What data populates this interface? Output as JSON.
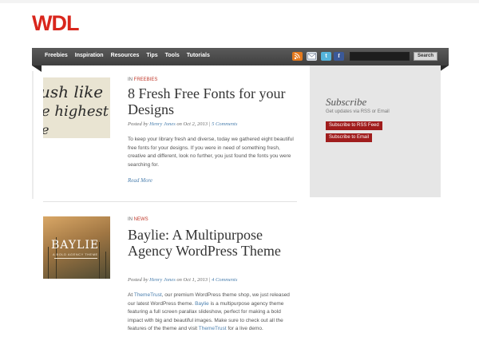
{
  "site": {
    "logo": "WDL"
  },
  "nav": {
    "items": [
      "Freebies",
      "Inspiration",
      "Resources",
      "Tips",
      "Tools",
      "Tutorials"
    ]
  },
  "social": {
    "icons": [
      "rss-icon",
      "mail-icon",
      "twitter-icon",
      "facebook-icon"
    ],
    "twitter_glyph": "t",
    "facebook_glyph": "f"
  },
  "search": {
    "button_label": "Search",
    "placeholder": "",
    "value": ""
  },
  "sidebar": {
    "title": "Subscribe",
    "subtitle": "Get updates via RSS or Email",
    "rss_button": "Subscribe to RSS Feed",
    "email_button": "Subscribe to Email"
  },
  "posts": [
    {
      "category_prefix": "IN",
      "category": "FREEBIES",
      "title": "8 Fresh Free Fonts for your Designs",
      "meta": {
        "posted_by": "Posted by",
        "author": "Henry Jones",
        "on": "on Oct 2, 2013",
        "sep": "|",
        "comments": "5 Comments"
      },
      "excerpt": "To keep your library fresh and diverse, today we gathered eight beautiful free fonts for your designs. If you were in need of something fresh, creative and different, look no further, you just found the fonts you were searching for.",
      "read_more": "Read More",
      "thumb_text": [
        "ush like",
        "e highest",
        "e"
      ]
    },
    {
      "category_prefix": "IN",
      "category": "NEWS",
      "title": "Baylie: A Multipurpose Agency WordPress Theme",
      "meta": {
        "posted_by": "Posted by",
        "author": "Henry Jones",
        "on": "on Oct 1, 2013",
        "sep": "|",
        "comments": "4 Comments"
      },
      "excerpt_parts": {
        "p1": "At ",
        "l1": "ThemeTrust",
        "p2": ", our premium WordPress theme shop, we just released our latest WordPress theme. ",
        "l2": "Baylie",
        "p3": " is a multipurpose agency theme featuring a full screen parallax slideshow, perfect for making a bold impact with big and beautiful images. Make sure to check out all the features of the theme and visit ",
        "l3": "ThemeTrust",
        "p4": " for a live demo."
      },
      "thumb_title": "BAYLIE",
      "thumb_sub": "A BOLD AGENCY THEME"
    }
  ],
  "colors": {
    "brand_red": "#d9261c",
    "nav_dark": "#4a4a4a",
    "button_red": "#a01d1d",
    "link_blue": "#4a7fae",
    "category_red": "#c0392b"
  }
}
